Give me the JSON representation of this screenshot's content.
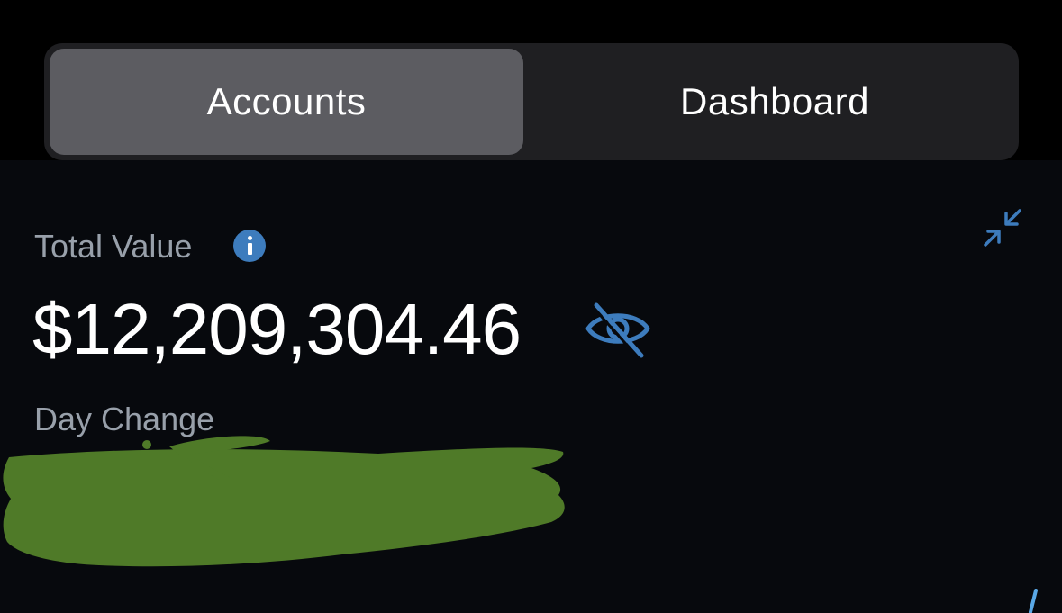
{
  "tabs": {
    "accounts_label": "Accounts",
    "dashboard_label": "Dashboard",
    "selected": "Accounts"
  },
  "summary": {
    "total_value_label": "Total Value",
    "total_value": "$12,209,304.46",
    "day_change_label": "Day Change"
  },
  "icons": {
    "info": "info-icon",
    "collapse": "collapse-arrows-icon",
    "visibility": "eye-slash-icon"
  },
  "colors": {
    "accent": "#3d7cbd",
    "segment_active": "#5c5c61",
    "segment_bg": "#1f1f22",
    "panel_bg": "#07090d",
    "label_gray": "#98a0aa",
    "redaction_green": "#4f7a28"
  }
}
